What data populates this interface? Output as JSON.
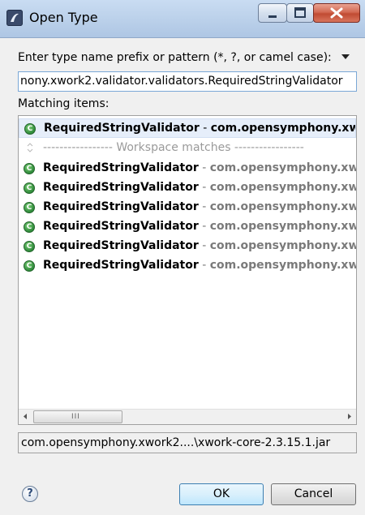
{
  "window": {
    "title": "Open Type"
  },
  "prompt": {
    "label": "Enter type name prefix or pattern (*, ?, or camel case):"
  },
  "pattern_input": {
    "value": "nony.xwork2.validator.validators.RequiredStringValidator"
  },
  "matching_label": "Matching items:",
  "results": {
    "selected": {
      "name": "RequiredStringValidator",
      "separator": " - ",
      "package": "com.opensymphony.xwo"
    },
    "workspace_separator": "----------------- Workspace matches -----------------",
    "items": [
      {
        "name": "RequiredStringValidator",
        "separator": " - ",
        "package": "com.opensymphony.xwo"
      },
      {
        "name": "RequiredStringValidator",
        "separator": " - ",
        "package": "com.opensymphony.xwo"
      },
      {
        "name": "RequiredStringValidator",
        "separator": " - ",
        "package": "com.opensymphony.xwo"
      },
      {
        "name": "RequiredStringValidator",
        "separator": " - ",
        "package": "com.opensymphony.xwo"
      },
      {
        "name": "RequiredStringValidator",
        "separator": " - ",
        "package": "com.opensymphony.xwo"
      },
      {
        "name": "RequiredStringValidator",
        "separator": " - ",
        "package": "com.opensymphony.xwo"
      }
    ],
    "class_icon_letter": "C"
  },
  "scrollbar": {
    "thumb_grip": "III"
  },
  "path_field": {
    "value": "com.opensymphony.xwork2....\\xwork-core-2.3.15.1.jar"
  },
  "footer": {
    "help_symbol": "?",
    "ok_label": "OK",
    "cancel_label": "Cancel"
  },
  "colors": {
    "title_bar": "#b9cfe9",
    "close_button": "#c14b33",
    "class_icon": "#2e8b3a",
    "selection": "#e6eefa",
    "dim_text": "#7a7a7a"
  },
  "icons": {
    "app": "eclipse-icon",
    "minimize": "minimize-icon",
    "maximize": "maximize-icon",
    "close": "close-icon",
    "menu": "dropdown-triangle-icon",
    "class": "class-icon",
    "help": "help-icon"
  }
}
